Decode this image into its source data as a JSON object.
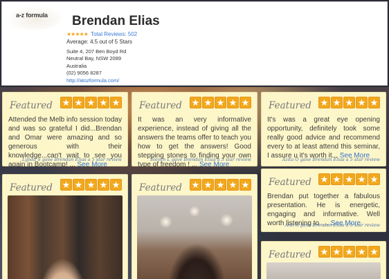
{
  "header": {
    "logo_text": "a-z formula",
    "business_name": "Brendan Elias",
    "mini_stars": "★★★★★",
    "total_reviews": "Total Reviews: 502",
    "average": "Average: 4.5 out of 5 Stars",
    "address_line1": "Suite 4, 207 Ben Boyd Rd",
    "address_line2": "Neutral Bay, NSW 2089",
    "address_line3": "Australia",
    "phone": "(02) 9056 8287",
    "website": "http://atozformula.com/"
  },
  "badge_label": "Featured",
  "star_glyph": "★",
  "more_label": "See More",
  "colors": {
    "card_bg": "#fdf6c9",
    "star": "#f2a81d",
    "link": "#2f6fc9"
  },
  "cards": [
    {
      "text": "Attended the Melb info session today and was so grateful I did...Brendan and Omar were amazing and so generous with their knowledge...can't wait to see you again in Bootcamp! ...",
      "attribution": "Lynda S gave Brendan Elias a 5 star review"
    },
    {
      "text": "It was an very informative experience, instead of giving all the answers the teams offer to teach you how to get the answers! Good stepping stones to finding your own type of freedom ! ...",
      "attribution": "Steven L gave Brendan Elias a 5 star review"
    },
    {
      "text": "It's was a great eye opening opportunity, definitely took some really good advice and recommend every to at least attend this seminar, I assure u it's worth it... ",
      "attribution": "Azita O gave Brendan Elias a 5 star review"
    },
    {
      "text": "Brendan put together a fabulous presentation. He is energetic, engaging and informative. Well worth listening to. ... ",
      "attribution": "Ann R gave Brendan Elias a 5 star review"
    }
  ]
}
